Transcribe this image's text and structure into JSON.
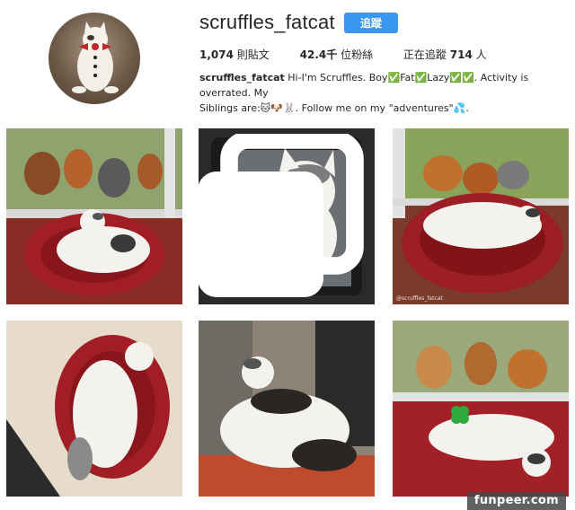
{
  "profile": {
    "username": "scruffles_fatcat",
    "follow_label": "追蹤",
    "avatar_icon": "cat-with-bow-avatar",
    "stats": {
      "posts_count": "1,074",
      "posts_label": "則貼文",
      "followers_count": "42.4千",
      "followers_label": "位粉絲",
      "following_label": "正在追蹤",
      "following_count": "714",
      "following_unit": "人"
    },
    "bio": {
      "name": "scruffles_fatcat",
      "line1": "Hi-I'm Scruffles. Boy✅Fat✅Lazy✅✅. Activity is overrated. My",
      "line2": "Siblings are:🐱🐶🐰. Follow me on my \"adventures\"💦."
    }
  },
  "posts": [
    {
      "alt": "cat on red cushion by window with chickens",
      "icon": null
    },
    {
      "alt": "cat sitting in dark window frame",
      "icon": "gallery-icon"
    },
    {
      "alt": "cat lying on red cushion with chickens outside",
      "icon": null,
      "caption": "@scruffles_fatcat"
    },
    {
      "alt": "cat sleeping on red cushion in sunlight",
      "icon": null
    },
    {
      "alt": "cat lying on floor near door",
      "icon": null
    },
    {
      "alt": "cat lying on red mat with clover sticker",
      "icon": "clover-icon"
    }
  ],
  "watermark": "funpeer.com",
  "colors": {
    "follow_button": "#3897f0",
    "text": "#262626",
    "cushion_red": "#9c1f25"
  }
}
